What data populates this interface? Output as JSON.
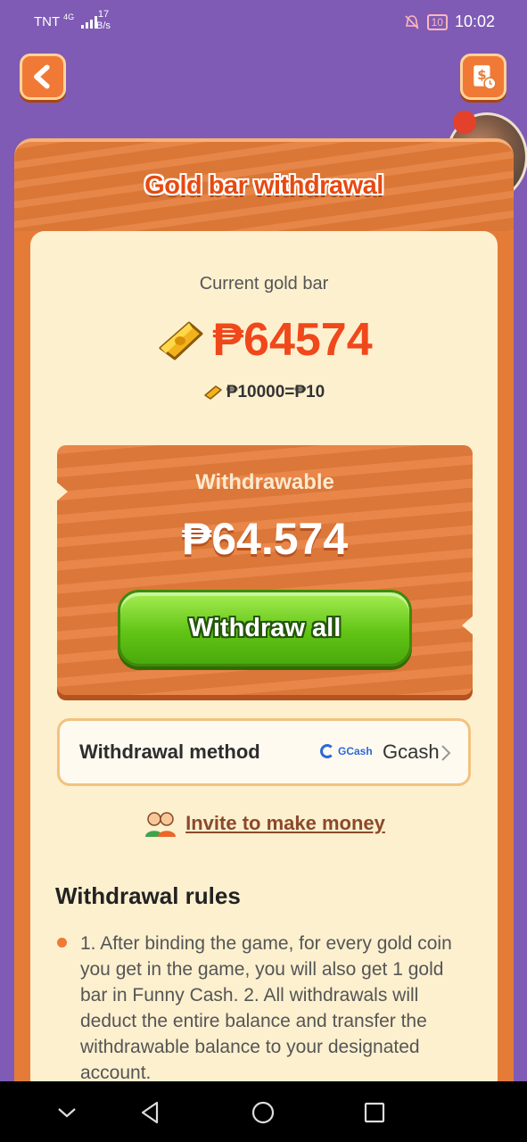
{
  "status_bar": {
    "carrier": "TNT",
    "network": "4G",
    "net_speed_value": "17",
    "net_speed_unit": "B/s",
    "battery": "10",
    "time": "10:02"
  },
  "header": {
    "back_icon": "chevron-left-icon",
    "record_icon": "dollar-clock-icon"
  },
  "panel": {
    "title": "Gold bar withdrawal"
  },
  "gold": {
    "label": "Current gold bar",
    "value": "₱64574",
    "rate": "₱10000=₱10"
  },
  "withdrawable": {
    "label": "Withdrawable",
    "amount": "₱64.574",
    "button_label": "Withdraw all"
  },
  "method": {
    "label": "Withdrawal method",
    "logo_text": "GCash",
    "value": "Gcash"
  },
  "invite": {
    "label": "Invite to make money"
  },
  "rules": {
    "title": "Withdrawal rules",
    "text": "1. After binding the game, for every gold coin you get in the game, you will also get 1 gold bar in Funny Cash. 2. All withdrawals will deduct the entire balance and transfer the withdrawable balance to your designated account."
  },
  "colors": {
    "background": "#7f5bb5",
    "wood": "#e47c38",
    "accent_red": "#f0481a",
    "button_green": "#62c416",
    "cream": "#fdf0cf"
  }
}
